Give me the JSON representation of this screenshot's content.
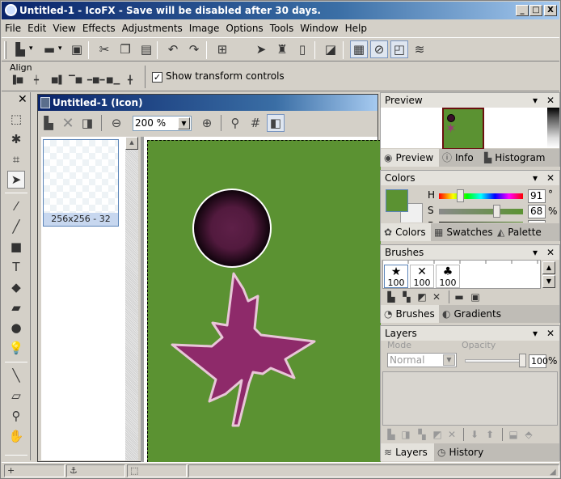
{
  "window": {
    "title": "Untitled-1 - IcoFX - Save will be disabled after 30 days.",
    "controls": [
      "_",
      "□",
      "X"
    ]
  },
  "menu": [
    "File",
    "Edit",
    "View",
    "Effects",
    "Adjustments",
    "Image",
    "Options",
    "Tools",
    "Window",
    "Help"
  ],
  "toolbar": {
    "items": [
      {
        "name": "new-icon",
        "glyph": "▙",
        "dropdown": true
      },
      {
        "name": "open-folder-icon",
        "glyph": "▬",
        "dropdown": true
      },
      {
        "name": "save-icon",
        "glyph": "▣"
      },
      {
        "name": "cut-icon",
        "glyph": "✂"
      },
      {
        "name": "copy-icon",
        "glyph": "❐"
      },
      {
        "name": "paste-icon",
        "glyph": "▤"
      },
      {
        "name": "undo-icon",
        "glyph": "↶"
      },
      {
        "name": "redo-icon",
        "glyph": "↷"
      },
      {
        "name": "windows-icon",
        "glyph": "⊞"
      },
      {
        "name": "apple-icon",
        "glyph": ""
      },
      {
        "name": "cursor-icon",
        "glyph": "➤"
      },
      {
        "name": "android-icon",
        "glyph": "♜"
      },
      {
        "name": "phone-icon",
        "glyph": "▯"
      },
      {
        "name": "import-icon",
        "glyph": "◪"
      },
      {
        "name": "checkerboard-icon",
        "glyph": "▦",
        "pressed": true
      },
      {
        "name": "hide-background-icon",
        "glyph": "⊘",
        "pressed": true
      },
      {
        "name": "selection-mask-icon",
        "glyph": "◰",
        "pressed": true
      },
      {
        "name": "layers-icon",
        "glyph": "≋"
      }
    ]
  },
  "options_bar": {
    "align_label": "Align",
    "align_buttons": [
      "align-left",
      "align-center-horizontal",
      "align-right",
      "align-top",
      "align-middle-vertical",
      "align-bottom",
      "align-center"
    ],
    "show_transform_label": "Show transform controls",
    "show_transform_checked": true
  },
  "toolbox": {
    "tools": [
      {
        "name": "rectangle-select-icon",
        "glyph": "⬚"
      },
      {
        "name": "magic-wand-icon",
        "glyph": "✱"
      },
      {
        "name": "crop-icon",
        "glyph": "⌗"
      },
      {
        "name": "move-icon",
        "glyph": "➤",
        "selected": true
      },
      {
        "name": "brush-icon",
        "glyph": "⁄"
      },
      {
        "name": "line-icon",
        "glyph": "╱"
      },
      {
        "name": "rectangle-icon",
        "glyph": "■"
      },
      {
        "name": "text-icon",
        "glyph": "T"
      },
      {
        "name": "fill-icon",
        "glyph": "◆"
      },
      {
        "name": "eraser-icon",
        "glyph": "▰"
      },
      {
        "name": "blur-icon",
        "glyph": "●"
      },
      {
        "name": "bulb-icon",
        "glyph": "💡"
      },
      {
        "name": "eyedropper-icon",
        "glyph": "╲"
      },
      {
        "name": "ruler-icon",
        "glyph": "▱"
      },
      {
        "name": "zoom-tool-icon",
        "glyph": "⚲"
      },
      {
        "name": "hand-icon",
        "glyph": "✋"
      }
    ]
  },
  "document": {
    "title": "Untitled-1 (Icon)",
    "zoom_value": "200 %",
    "format_caption": "256x256 - 32"
  },
  "preview_panel": {
    "title": "Preview",
    "tabs": [
      {
        "label": "Preview",
        "icon": "eye-icon",
        "active": true
      },
      {
        "label": "Info",
        "icon": "info-icon"
      },
      {
        "label": "Histogram",
        "icon": "histogram-icon"
      }
    ]
  },
  "colors_panel": {
    "title": "Colors",
    "primary_color": "#5b9232",
    "h_label": "H",
    "h_value": "91",
    "h_unit": "°",
    "s_label": "S",
    "s_value": "68",
    "s_unit": "%",
    "b_label": "B",
    "h_fraction": 0.25,
    "s_fraction": 0.68,
    "tabs": [
      {
        "label": "Colors",
        "icon": "palette-icon",
        "active": true
      },
      {
        "label": "Swatches",
        "icon": "swatches-icon"
      },
      {
        "label": "Palette",
        "icon": "color-palette-icon"
      }
    ]
  },
  "brushes_panel": {
    "title": "Brushes",
    "brushes": [
      {
        "glyph": "★",
        "size": "100",
        "selected": true
      },
      {
        "glyph": "✕",
        "size": "100"
      },
      {
        "glyph": "♣",
        "size": "100"
      }
    ],
    "tabs": [
      {
        "label": "Brushes",
        "icon": "brushes-icon",
        "active": true
      },
      {
        "label": "Gradients",
        "icon": "gradients-icon"
      }
    ]
  },
  "layers_panel": {
    "title": "Layers",
    "mode_label": "Mode",
    "mode_value": "Normal",
    "opacity_label": "Opacity",
    "opacity_value": "100",
    "opacity_unit": "%",
    "tabs": [
      {
        "label": "Layers",
        "icon": "layers-stack-icon",
        "active": true
      },
      {
        "label": "History",
        "icon": "history-icon"
      }
    ]
  },
  "status_bar": {
    "cells": [
      {
        "icon": "crosshair-icon",
        "glyph": "+"
      },
      {
        "icon": "anchor-icon",
        "glyph": "⚓"
      },
      {
        "icon": "selection-size-icon",
        "glyph": "⬚"
      }
    ]
  },
  "colors": {
    "canvas_green": "#5b9232",
    "leaf_purple": "#8e2a6a",
    "title_blue": "#0a246a"
  }
}
